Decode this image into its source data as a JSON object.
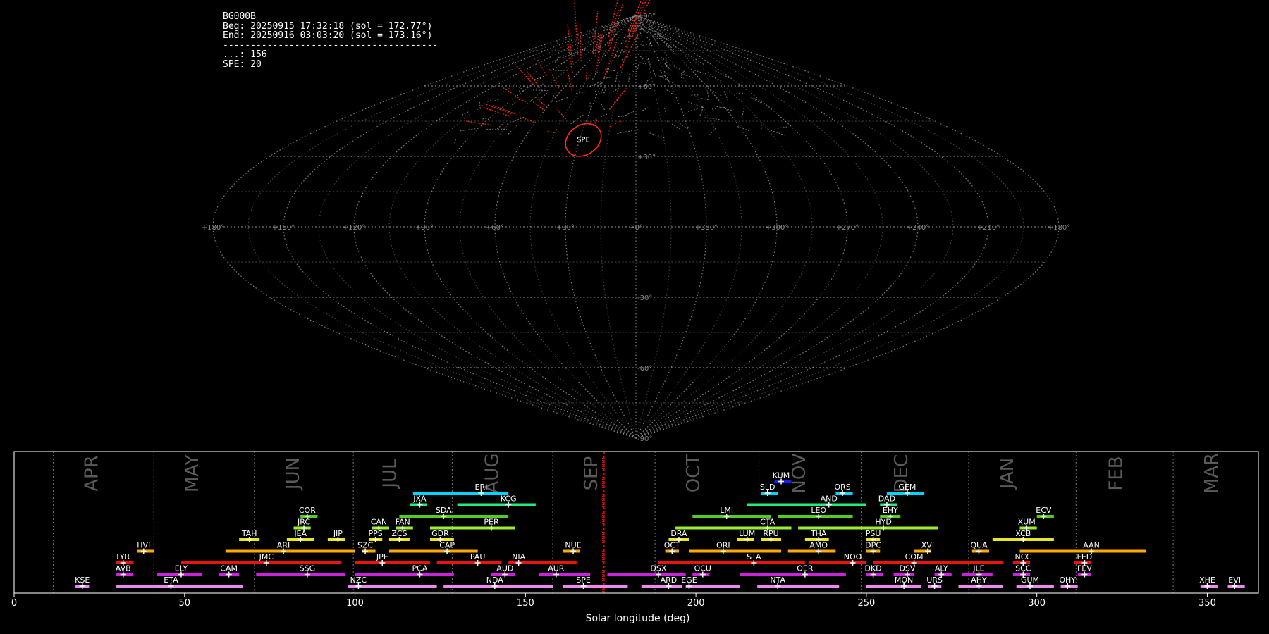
{
  "header": {
    "station": "BG000B",
    "begin": "Beg: 20250915 17:32:18 (sol = 172.77°)",
    "end": "End: 20250916 03:03:20 (sol = 173.16°)",
    "separator": "---------------------------------------",
    "sporadic_line": "...: 156",
    "spe_line": "SPE: 20"
  },
  "colors": {
    "background": "#000000",
    "grid": "#8a8a8a",
    "meteor_sporadic": "#9a9a9a",
    "meteor_shower": "#ff2a1a",
    "current_sol": "#ff0000",
    "month_label": "#5a5a5a",
    "axis": "#ffffff"
  },
  "chart_data": [
    {
      "type": "scatter",
      "projection": "sinusoidal",
      "title": "",
      "lon_ticks": [
        "+180°",
        "+150°",
        "+120°",
        "+90°",
        "+60°",
        "+30°",
        "+0°",
        "+330°",
        "+300°",
        "+270°",
        "+240°",
        "+210°",
        "+180°"
      ],
      "lat_ticks": [
        "+90°",
        "+60°",
        "+30°",
        "-30°",
        "-60°",
        "-90°"
      ],
      "radiant_marker": {
        "label": "SPE",
        "lon": 28,
        "lat": 37
      },
      "series": [
        {
          "name": "SPE",
          "count": 20
        },
        {
          "name": "...",
          "count": 156
        }
      ]
    },
    {
      "type": "bar",
      "xlabel": "Solar longitude (deg)",
      "xlim": [
        0,
        365
      ],
      "xticks": [
        0,
        50,
        100,
        150,
        200,
        250,
        300,
        350
      ],
      "current_sol": 173.0,
      "months": [
        {
          "label": "APR",
          "start": 11.5,
          "center": 24.5
        },
        {
          "label": "MAY",
          "start": 41,
          "center": 54
        },
        {
          "label": "JUN",
          "start": 70.5,
          "center": 83.5
        },
        {
          "label": "JUL",
          "start": 99.5,
          "center": 112
        },
        {
          "label": "AUG",
          "start": 128.5,
          "center": 142
        },
        {
          "label": "SEP",
          "start": 158,
          "center": 171
        },
        {
          "label": "OCT",
          "start": 188,
          "center": 201
        },
        {
          "label": "NOV",
          "start": 218.5,
          "center": 232
        },
        {
          "label": "DEC",
          "start": 248.5,
          "center": 262
        },
        {
          "label": "JAN",
          "start": 280,
          "center": 293
        },
        {
          "label": "FEB",
          "start": 311.5,
          "center": 325
        },
        {
          "label": "MAR",
          "start": 340,
          "center": 353
        }
      ],
      "showers": [
        {
          "code": "KUM",
          "start": 223,
          "end": 228,
          "peak": 225,
          "row": 10,
          "color": "#1a1aff"
        },
        {
          "code": "ERI",
          "start": 117,
          "end": 145,
          "peak": 137,
          "row": 9,
          "color": "#00d4ff"
        },
        {
          "code": "SLD",
          "start": 219,
          "end": 224,
          "peak": 221,
          "row": 9,
          "color": "#00d4ff"
        },
        {
          "code": "ORS",
          "start": 241,
          "end": 246,
          "peak": 243,
          "row": 9,
          "color": "#00d4ff"
        },
        {
          "code": "GEM",
          "start": 256,
          "end": 267,
          "peak": 262,
          "row": 9,
          "color": "#00d4ff"
        },
        {
          "code": "JXA",
          "start": 116,
          "end": 121,
          "peak": 119,
          "row": 8,
          "color": "#22ee77"
        },
        {
          "code": "KCG",
          "start": 130,
          "end": 153,
          "peak": 145,
          "row": 8,
          "color": "#22ee77"
        },
        {
          "code": "AND",
          "start": 215,
          "end": 250,
          "peak": 239,
          "row": 8,
          "color": "#22ee77"
        },
        {
          "code": "DAD",
          "start": 254,
          "end": 259,
          "peak": 256,
          "row": 8,
          "color": "#22ee77"
        },
        {
          "code": "COR",
          "start": 84,
          "end": 89,
          "peak": 86,
          "row": 7,
          "color": "#55cc22"
        },
        {
          "code": "SDA",
          "start": 113,
          "end": 145,
          "peak": 126,
          "row": 7,
          "color": "#55cc22"
        },
        {
          "code": "LMI",
          "start": 199,
          "end": 222,
          "peak": 209,
          "row": 7,
          "color": "#55cc22"
        },
        {
          "code": "LEO",
          "start": 224,
          "end": 246,
          "peak": 236,
          "row": 7,
          "color": "#55cc22"
        },
        {
          "code": "EHY",
          "start": 254,
          "end": 260,
          "peak": 257,
          "row": 7,
          "color": "#55cc22"
        },
        {
          "code": "ECV",
          "start": 300,
          "end": 305,
          "peak": 302,
          "row": 7,
          "color": "#55cc22"
        },
        {
          "code": "JRC",
          "start": 82,
          "end": 87,
          "peak": 85,
          "row": 6,
          "color": "#99ee33"
        },
        {
          "code": "CAN",
          "start": 105,
          "end": 110,
          "peak": 107,
          "row": 6,
          "color": "#99ee33"
        },
        {
          "code": "FAN",
          "start": 112,
          "end": 117,
          "peak": 114,
          "row": 6,
          "color": "#99ee33"
        },
        {
          "code": "PER",
          "start": 122,
          "end": 147,
          "peak": 140,
          "row": 6,
          "color": "#99ee33"
        },
        {
          "code": "CTA",
          "start": 194,
          "end": 228,
          "peak": 221,
          "row": 6,
          "color": "#99ee33"
        },
        {
          "code": "HYD",
          "start": 230,
          "end": 271,
          "peak": 255,
          "row": 6,
          "color": "#99ee33"
        },
        {
          "code": "XUM",
          "start": 295,
          "end": 300,
          "peak": 297,
          "row": 6,
          "color": "#99ee33"
        },
        {
          "code": "TAH",
          "start": 66,
          "end": 72,
          "peak": 69,
          "row": 5,
          "color": "#e8e822"
        },
        {
          "code": "JEA",
          "start": 80,
          "end": 88,
          "peak": 84,
          "row": 5,
          "color": "#e8e822"
        },
        {
          "code": "JIP",
          "start": 92,
          "end": 97,
          "peak": 95,
          "row": 5,
          "color": "#e8e822"
        },
        {
          "code": "PPS",
          "start": 104,
          "end": 108,
          "peak": 106,
          "row": 5,
          "color": "#e8e822"
        },
        {
          "code": "ZCS",
          "start": 110,
          "end": 116,
          "peak": 113,
          "row": 5,
          "color": "#e8e822"
        },
        {
          "code": "GDR",
          "start": 122,
          "end": 129,
          "peak": 125,
          "row": 5,
          "color": "#e8e822"
        },
        {
          "code": "DRA",
          "start": 192,
          "end": 198,
          "peak": 195,
          "row": 5,
          "color": "#e8e822"
        },
        {
          "code": "LUM",
          "start": 212,
          "end": 217,
          "peak": 215,
          "row": 5,
          "color": "#e8e822"
        },
        {
          "code": "RPU",
          "start": 219,
          "end": 225,
          "peak": 222,
          "row": 5,
          "color": "#e8e822"
        },
        {
          "code": "THA",
          "start": 232,
          "end": 239,
          "peak": 236,
          "row": 5,
          "color": "#e8e822"
        },
        {
          "code": "PSU",
          "start": 250,
          "end": 254,
          "peak": 252,
          "row": 5,
          "color": "#e8e822"
        },
        {
          "code": "XCB",
          "start": 287,
          "end": 305,
          "peak": 296,
          "row": 5,
          "color": "#e8e822"
        },
        {
          "code": "HVI",
          "start": 36,
          "end": 41,
          "peak": 38,
          "row": 4,
          "color": "#ffaa00"
        },
        {
          "code": "ARI",
          "start": 62,
          "end": 100,
          "peak": 79,
          "row": 4,
          "color": "#ffaa00"
        },
        {
          "code": "SZC",
          "start": 102,
          "end": 106,
          "peak": 103,
          "row": 4,
          "color": "#ffaa00"
        },
        {
          "code": "CAP",
          "start": 110,
          "end": 136,
          "peak": 127,
          "row": 4,
          "color": "#ffaa00"
        },
        {
          "code": "NUE",
          "start": 161,
          "end": 166,
          "peak": 164,
          "row": 4,
          "color": "#ffaa00"
        },
        {
          "code": "OCT",
          "start": 191,
          "end": 195,
          "peak": 193,
          "row": 4,
          "color": "#ffaa00"
        },
        {
          "code": "ORI",
          "start": 198,
          "end": 225,
          "peak": 208,
          "row": 4,
          "color": "#ffaa00"
        },
        {
          "code": "AMO",
          "start": 227,
          "end": 241,
          "peak": 236,
          "row": 4,
          "color": "#ffaa00"
        },
        {
          "code": "DPC",
          "start": 250,
          "end": 254,
          "peak": 252,
          "row": 4,
          "color": "#ffaa00"
        },
        {
          "code": "XVI",
          "start": 264,
          "end": 269,
          "peak": 268,
          "row": 4,
          "color": "#ffaa00"
        },
        {
          "code": "QUA",
          "start": 281,
          "end": 286,
          "peak": 283,
          "row": 4,
          "color": "#ffaa00"
        },
        {
          "code": "AAN",
          "start": 295,
          "end": 332,
          "peak": 316,
          "row": 4,
          "color": "#ffaa00"
        },
        {
          "code": "LYR",
          "start": 30,
          "end": 35,
          "peak": 32,
          "row": 3,
          "color": "#ee1111"
        },
        {
          "code": "JMC",
          "start": 49,
          "end": 96,
          "peak": 74,
          "row": 3,
          "color": "#ee1111"
        },
        {
          "code": "JPE",
          "start": 100,
          "end": 122,
          "peak": 108,
          "row": 3,
          "color": "#ee1111"
        },
        {
          "code": "PAU",
          "start": 124,
          "end": 143,
          "peak": 136,
          "row": 3,
          "color": "#ee1111"
        },
        {
          "code": "NIA",
          "start": 145,
          "end": 165,
          "peak": 148,
          "row": 3,
          "color": "#ee1111"
        },
        {
          "code": "STA",
          "start": 189,
          "end": 232,
          "peak": 217,
          "row": 3,
          "color": "#ee1111"
        },
        {
          "code": "NOO",
          "start": 233,
          "end": 250,
          "peak": 246,
          "row": 3,
          "color": "#ee1111"
        },
        {
          "code": "COM",
          "start": 252,
          "end": 290,
          "peak": 264,
          "row": 3,
          "color": "#ee1111"
        },
        {
          "code": "NCC",
          "start": 293,
          "end": 298,
          "peak": 296,
          "row": 3,
          "color": "#ee1111"
        },
        {
          "code": "FED",
          "start": 311,
          "end": 316,
          "peak": 314,
          "row": 3,
          "color": "#ee1111"
        },
        {
          "code": "AVB",
          "start": 30,
          "end": 35,
          "peak": 32,
          "row": 2,
          "color": "#cc22dd"
        },
        {
          "code": "ELY",
          "start": 42,
          "end": 55,
          "peak": 49,
          "row": 2,
          "color": "#cc22dd"
        },
        {
          "code": "CAM",
          "start": 60,
          "end": 66,
          "peak": 63,
          "row": 2,
          "color": "#cc22dd"
        },
        {
          "code": "SSG",
          "start": 71,
          "end": 97,
          "peak": 86,
          "row": 2,
          "color": "#cc22dd"
        },
        {
          "code": "PCA",
          "start": 100,
          "end": 129,
          "peak": 119,
          "row": 2,
          "color": "#cc22dd"
        },
        {
          "code": "AUD",
          "start": 140,
          "end": 147,
          "peak": 144,
          "row": 2,
          "color": "#cc22dd"
        },
        {
          "code": "AUR",
          "start": 154,
          "end": 169,
          "peak": 159,
          "row": 2,
          "color": "#cc22dd"
        },
        {
          "code": "DSX",
          "start": 174,
          "end": 197,
          "peak": 189,
          "row": 2,
          "color": "#cc22dd"
        },
        {
          "code": "OCU",
          "start": 199,
          "end": 204,
          "peak": 202,
          "row": 2,
          "color": "#cc22dd"
        },
        {
          "code": "OER",
          "start": 213,
          "end": 244,
          "peak": 232,
          "row": 2,
          "color": "#cc22dd"
        },
        {
          "code": "DKD",
          "start": 250,
          "end": 255,
          "peak": 252,
          "row": 2,
          "color": "#cc22dd"
        },
        {
          "code": "DSV",
          "start": 258,
          "end": 264,
          "peak": 262,
          "row": 2,
          "color": "#cc22dd"
        },
        {
          "code": "ALY",
          "start": 270,
          "end": 275,
          "peak": 272,
          "row": 2,
          "color": "#cc22dd"
        },
        {
          "code": "JLE",
          "start": 278,
          "end": 287,
          "peak": 283,
          "row": 2,
          "color": "#cc22dd"
        },
        {
          "code": "SCC",
          "start": 293,
          "end": 298,
          "peak": 296,
          "row": 2,
          "color": "#cc22dd"
        },
        {
          "code": "FEV",
          "start": 312,
          "end": 316,
          "peak": 314,
          "row": 2,
          "color": "#cc22dd"
        },
        {
          "code": "KSE",
          "start": 18,
          "end": 22,
          "peak": 20,
          "row": 1,
          "color": "#ee88ee"
        },
        {
          "code": "ETA",
          "start": 30,
          "end": 67,
          "peak": 46,
          "row": 1,
          "color": "#ee88ee"
        },
        {
          "code": "NZC",
          "start": 98,
          "end": 124,
          "peak": 101,
          "row": 1,
          "color": "#ee88ee"
        },
        {
          "code": "NDA",
          "start": 126,
          "end": 158,
          "peak": 141,
          "row": 1,
          "color": "#ee88ee"
        },
        {
          "code": "SPE",
          "start": 161,
          "end": 180,
          "peak": 167,
          "row": 1,
          "color": "#ee88ee"
        },
        {
          "code": "ARD",
          "start": 184,
          "end": 196,
          "peak": 192,
          "row": 1,
          "color": "#ee88ee"
        },
        {
          "code": "EGE",
          "start": 197,
          "end": 213,
          "peak": 198,
          "row": 1,
          "color": "#ee88ee"
        },
        {
          "code": "NTA",
          "start": 218,
          "end": 242,
          "peak": 224,
          "row": 1,
          "color": "#ee88ee"
        },
        {
          "code": "MON",
          "start": 250,
          "end": 266,
          "peak": 261,
          "row": 1,
          "color": "#ee88ee"
        },
        {
          "code": "URS",
          "start": 268,
          "end": 272,
          "peak": 270,
          "row": 1,
          "color": "#ee88ee"
        },
        {
          "code": "AHY",
          "start": 277,
          "end": 290,
          "peak": 283,
          "row": 1,
          "color": "#ee88ee"
        },
        {
          "code": "GUM",
          "start": 294,
          "end": 305,
          "peak": 298,
          "row": 1,
          "color": "#ee88ee"
        },
        {
          "code": "OHY",
          "start": 307,
          "end": 312,
          "peak": 309,
          "row": 1,
          "color": "#ee88ee"
        },
        {
          "code": "XHE",
          "start": 348,
          "end": 353,
          "peak": 350,
          "row": 1,
          "color": "#ee88ee"
        },
        {
          "code": "EVI",
          "start": 356,
          "end": 361,
          "peak": 358,
          "row": 1,
          "color": "#ee88ee"
        }
      ]
    }
  ]
}
